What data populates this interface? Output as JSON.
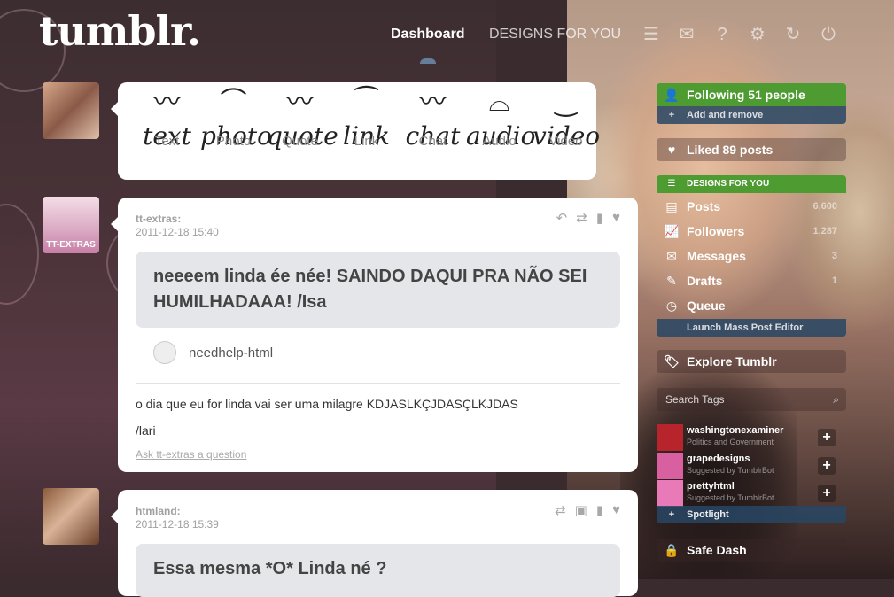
{
  "header": {
    "logo": "tumblr.",
    "nav_dashboard": "Dashboard",
    "nav_designs": "DESIGNS FOR YOU"
  },
  "compose": {
    "items": [
      {
        "script": "text",
        "label": "Text"
      },
      {
        "script": "photo",
        "label": "Photo"
      },
      {
        "script": "quote",
        "label": "Quote"
      },
      {
        "script": "link",
        "label": "Link"
      },
      {
        "script": "chat",
        "label": "Chat"
      },
      {
        "script": "audio",
        "label": "Audio"
      },
      {
        "script": "video",
        "label": "Video"
      }
    ]
  },
  "posts": [
    {
      "user": "tt-extras:",
      "date": "2011-12-18 15:40",
      "avatar_tag": "TT-EXTRAS",
      "question": "neeeem linda ée née! SAINDO DAQUI PRA NÃO SEI HUMILHADAAA! /Isa",
      "asker": "needhelp-html",
      "answer": "o dia que eu for linda vai ser uma milagre KDJASLKÇJDASÇLKJDAS",
      "answer_sign": "/lari",
      "ask_link": "Ask tt-extras a question"
    },
    {
      "user": "htmland:",
      "date": "2011-12-18 15:39",
      "question": "Essa mesma *O* Linda né ?"
    }
  ],
  "sidebar": {
    "following": "Following 51 people",
    "add_remove": "Add and remove",
    "liked": "Liked 89 posts",
    "designs_for_you": "DESIGNS FOR YOU",
    "stats": [
      {
        "label": "Posts",
        "count": "6,600",
        "icon": "posts-icon"
      },
      {
        "label": "Followers",
        "count": "1,287",
        "icon": "followers-icon"
      },
      {
        "label": "Messages",
        "count": "3",
        "icon": "messages-icon"
      },
      {
        "label": "Drafts",
        "count": "1",
        "icon": "drafts-icon"
      },
      {
        "label": "Queue",
        "count": "",
        "icon": "queue-icon"
      }
    ],
    "launch_mass": "Launch Mass Post Editor",
    "explore": "Explore Tumblr",
    "search_tags": "Search Tags",
    "recommendations": [
      {
        "name": "washingtonexaminer",
        "sub": "Politics and Government",
        "avatar_color": "#b8242c"
      },
      {
        "name": "grapedesigns",
        "sub": "Suggested by TumblrBot",
        "avatar_color": "#d85fa0"
      },
      {
        "name": "prettyhtml",
        "sub": "Suggested by TumblrBot",
        "avatar_color": "#e87ab8"
      }
    ],
    "spotlight": "Spotlight",
    "safe_dash": "Safe Dash"
  },
  "colors": {
    "green": "#4d9b31",
    "blue_bar": "#2c4a6a"
  }
}
